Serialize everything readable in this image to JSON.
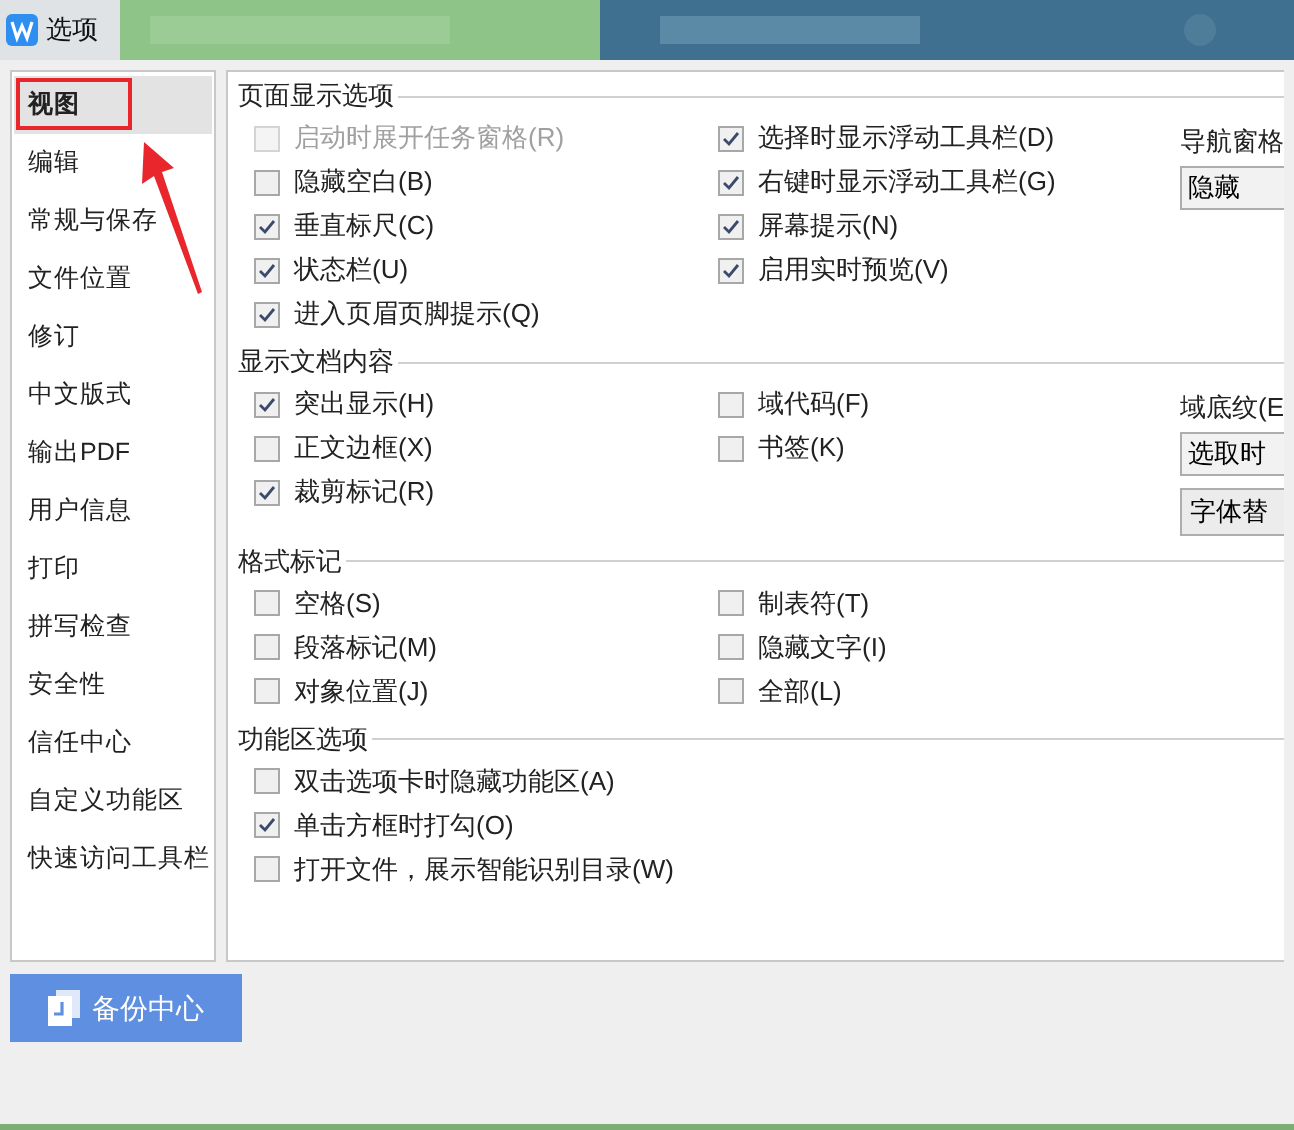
{
  "window": {
    "title": "选项"
  },
  "sidebar": {
    "items": [
      {
        "label": "视图",
        "selected": true
      },
      {
        "label": "编辑",
        "selected": false
      },
      {
        "label": "常规与保存",
        "selected": false
      },
      {
        "label": "文件位置",
        "selected": false
      },
      {
        "label": "修订",
        "selected": false
      },
      {
        "label": "中文版式",
        "selected": false
      },
      {
        "label": "输出PDF",
        "selected": false
      },
      {
        "label": "用户信息",
        "selected": false
      },
      {
        "label": "打印",
        "selected": false
      },
      {
        "label": "拼写检查",
        "selected": false
      },
      {
        "label": "安全性",
        "selected": false
      },
      {
        "label": "信任中心",
        "selected": false
      },
      {
        "label": "自定义功能区",
        "selected": false
      },
      {
        "label": "快速访问工具栏",
        "selected": false
      }
    ]
  },
  "backup_button": {
    "label": "备份中心"
  },
  "sections": [
    {
      "title": "页面显示选项",
      "columns": [
        [
          {
            "label": "启动时展开任务窗格(R)",
            "checked": false,
            "disabled": true
          },
          {
            "label": "隐藏空白(B)",
            "checked": false,
            "disabled": false
          },
          {
            "label": "垂直标尺(C)",
            "checked": true,
            "disabled": false
          },
          {
            "label": "状态栏(U)",
            "checked": true,
            "disabled": false
          },
          {
            "label": "进入页眉页脚提示(Q)",
            "checked": true,
            "disabled": false
          }
        ],
        [
          {
            "label": "选择时显示浮动工具栏(D)",
            "checked": true,
            "disabled": false
          },
          {
            "label": "右键时显示浮动工具栏(G)",
            "checked": true,
            "disabled": false
          },
          {
            "label": "屏幕提示(N)",
            "checked": true,
            "disabled": false
          },
          {
            "label": "启用实时预览(V)",
            "checked": true,
            "disabled": false
          }
        ]
      ],
      "side": [
        {
          "kind": "label",
          "text": "导航窗格"
        },
        {
          "kind": "dropdown",
          "text": "隐藏"
        }
      ]
    },
    {
      "title": "显示文档内容",
      "columns": [
        [
          {
            "label": "突出显示(H)",
            "checked": true,
            "disabled": false
          },
          {
            "label": "正文边框(X)",
            "checked": false,
            "disabled": false
          },
          {
            "label": "裁剪标记(R)",
            "checked": true,
            "disabled": false
          }
        ],
        [
          {
            "label": "域代码(F)",
            "checked": false,
            "disabled": false
          },
          {
            "label": "书签(K)",
            "checked": false,
            "disabled": false
          }
        ]
      ],
      "side": [
        {
          "kind": "label",
          "text": "域底纹(E"
        },
        {
          "kind": "dropdown",
          "text": "选取时"
        },
        {
          "kind": "button",
          "text": "字体替"
        }
      ]
    },
    {
      "title": "格式标记",
      "columns": [
        [
          {
            "label": "空格(S)",
            "checked": false,
            "disabled": false
          },
          {
            "label": "段落标记(M)",
            "checked": false,
            "disabled": false
          },
          {
            "label": "对象位置(J)",
            "checked": false,
            "disabled": false
          }
        ],
        [
          {
            "label": "制表符(T)",
            "checked": false,
            "disabled": false
          },
          {
            "label": "隐藏文字(I)",
            "checked": false,
            "disabled": false
          },
          {
            "label": "全部(L)",
            "checked": false,
            "disabled": false
          }
        ]
      ]
    },
    {
      "title": "功能区选项",
      "columns": [
        [
          {
            "label": "双击选项卡时隐藏功能区(A)",
            "checked": false,
            "disabled": false
          },
          {
            "label": "单击方框时打勾(O)",
            "checked": true,
            "disabled": false
          },
          {
            "label": "打开文件，展示智能识别目录(W)",
            "checked": false,
            "disabled": false
          }
        ]
      ]
    }
  ]
}
